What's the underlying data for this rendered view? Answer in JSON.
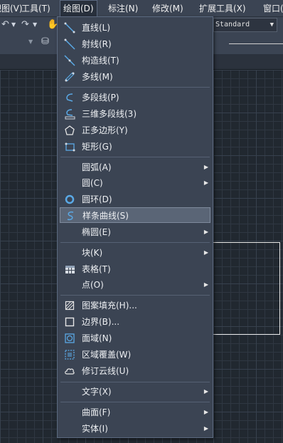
{
  "menubar": {
    "items": [
      "视图(V)",
      "工具(T)",
      "绘图(D)",
      "标注(N)",
      "修改(M)",
      "扩展工具(X)",
      "窗口(W)"
    ]
  },
  "toolbar": {
    "text_style_value": "Standard"
  },
  "draw_menu": {
    "items": [
      {
        "label": "直线(L)",
        "icon": "line-icon",
        "submenu": false
      },
      {
        "label": "射线(R)",
        "icon": "ray-icon",
        "submenu": false
      },
      {
        "label": "构造线(T)",
        "icon": "construction-line-icon",
        "submenu": false
      },
      {
        "label": "多线(M)",
        "icon": "multiline-icon",
        "submenu": false
      },
      {
        "label": "多段线(P)",
        "icon": "polyline-icon",
        "submenu": false
      },
      {
        "label": "三维多段线(3)",
        "icon": "3d-polyline-icon",
        "submenu": false
      },
      {
        "label": "正多边形(Y)",
        "icon": "polygon-icon",
        "submenu": false
      },
      {
        "label": "矩形(G)",
        "icon": "rectangle-icon",
        "submenu": false
      },
      {
        "label": "圆弧(A)",
        "icon": "",
        "submenu": true
      },
      {
        "label": "圆(C)",
        "icon": "",
        "submenu": true
      },
      {
        "label": "圆环(D)",
        "icon": "donut-icon",
        "submenu": false
      },
      {
        "label": "样条曲线(S)",
        "icon": "spline-icon",
        "submenu": false,
        "highlighted": true
      },
      {
        "label": "椭圆(E)",
        "icon": "",
        "submenu": true
      },
      {
        "label": "块(K)",
        "icon": "",
        "submenu": true
      },
      {
        "label": "表格(T)",
        "icon": "table-icon",
        "submenu": false
      },
      {
        "label": "点(O)",
        "icon": "",
        "submenu": true
      },
      {
        "label": "图案填充(H)...",
        "icon": "hatch-icon",
        "submenu": false
      },
      {
        "label": "边界(B)...",
        "icon": "boundary-icon",
        "submenu": false
      },
      {
        "label": "面域(N)",
        "icon": "region-icon",
        "submenu": false
      },
      {
        "label": "区域覆盖(W)",
        "icon": "wipeout-icon",
        "submenu": false
      },
      {
        "label": "修订云线(U)",
        "icon": "revision-cloud-icon",
        "submenu": false
      },
      {
        "label": "文字(X)",
        "icon": "",
        "submenu": true
      },
      {
        "label": "曲面(F)",
        "icon": "",
        "submenu": true
      },
      {
        "label": "实体(I)",
        "icon": "",
        "submenu": true
      }
    ]
  },
  "colors": {
    "menu_bg": "#3b4453",
    "highlight_bg": "#5a6576",
    "canvas_bg": "#212830",
    "icon_blue": "#5aa9e6"
  }
}
